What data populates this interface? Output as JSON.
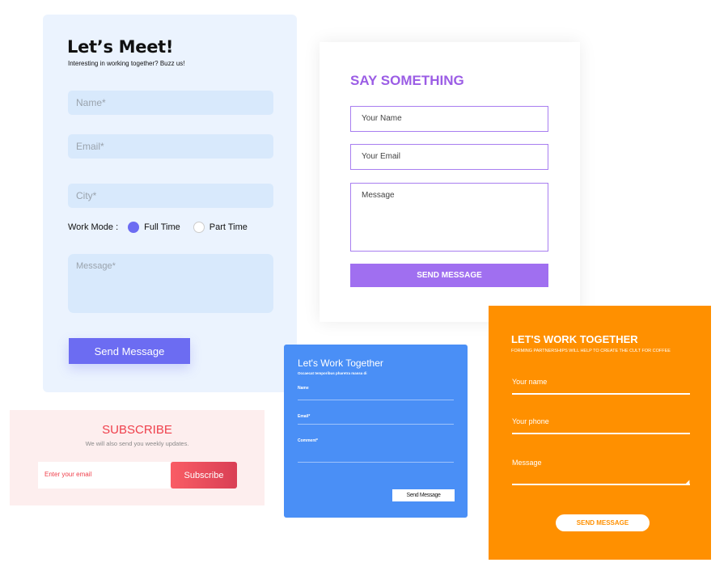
{
  "meet_form": {
    "title": "Let’s Meet!",
    "subtitle": "Interesting in working together? Buzz us!",
    "name_placeholder": "Name*",
    "email_placeholder": "Email*",
    "city_placeholder": "City*",
    "work_mode_label": "Work Mode :",
    "work_mode_options": [
      {
        "label": "Full Time",
        "selected": true
      },
      {
        "label": "Part Time",
        "selected": false
      }
    ],
    "message_placeholder": "Message*",
    "send_label": "Send Message",
    "accent_color": "#6c6cf2"
  },
  "say_form": {
    "title": "SAY SOMETHING",
    "name_placeholder": "Your Name",
    "email_placeholder": "Your Email",
    "message_placeholder": "Message",
    "send_label": "SEND MESSAGE",
    "accent_color": "#a06ff0"
  },
  "subscribe_form": {
    "title": "SUBSCRIBE",
    "subtitle": "We will also send you weekly updates.",
    "email_placeholder": "Enter your email",
    "button_label": "Subscribe",
    "accent_color": "#ef3f4b"
  },
  "blue_form": {
    "title": "Let's Work Together",
    "subtitle": "Occaecat temporibus pharetra massa di",
    "name_label": "Name",
    "email_label": "Email*",
    "comment_label": "Comment*",
    "send_label": "Send Message",
    "accent_color": "#4a8ff6"
  },
  "orange_form": {
    "title": "LET'S WORK TOGETHER",
    "subtitle": "FORMING PARTNERSHIPS WILL HELP TO CREATE THE CULT FOR COFFEE",
    "name_placeholder": "Your name",
    "phone_placeholder": "Your phone",
    "message_placeholder": "Message",
    "send_label": "SEND MESSAGE",
    "accent_color": "#ff9000"
  }
}
